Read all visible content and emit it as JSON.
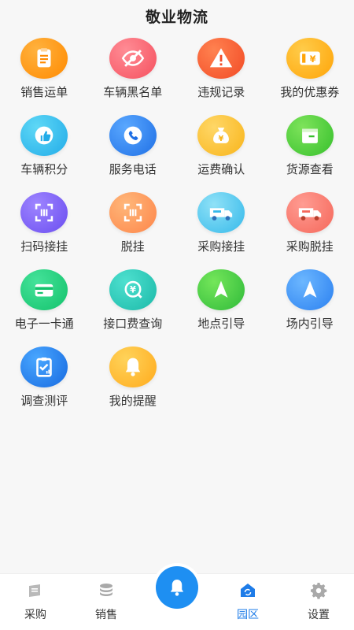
{
  "header": {
    "title": "敬业物流"
  },
  "grid": {
    "items": [
      {
        "label": "销售运单",
        "icon": "clipboard-icon"
      },
      {
        "label": "车辆黑名单",
        "icon": "eye-off-icon"
      },
      {
        "label": "违规记录",
        "icon": "warning-icon"
      },
      {
        "label": "我的优惠券",
        "icon": "coupon-icon"
      },
      {
        "label": "车辆积分",
        "icon": "thumbs-up-icon"
      },
      {
        "label": "服务电话",
        "icon": "phone-icon"
      },
      {
        "label": "运费确认",
        "icon": "money-bag-icon"
      },
      {
        "label": "货源查看",
        "icon": "box-icon"
      },
      {
        "label": "扫码接挂",
        "icon": "scan-icon"
      },
      {
        "label": "脱挂",
        "icon": "scan-icon"
      },
      {
        "label": "采购接挂",
        "icon": "truck-icon"
      },
      {
        "label": "采购脱挂",
        "icon": "truck-icon"
      },
      {
        "label": "电子一卡通",
        "icon": "card-icon"
      },
      {
        "label": "接口费查询",
        "icon": "yen-search-icon"
      },
      {
        "label": "地点引导",
        "icon": "navigation-icon"
      },
      {
        "label": "场内引导",
        "icon": "navigation-icon"
      },
      {
        "label": "调查测评",
        "icon": "survey-icon"
      },
      {
        "label": "我的提醒",
        "icon": "bell-icon"
      }
    ]
  },
  "tabbar": {
    "tabs": [
      {
        "label": "采购",
        "icon": "purchase-icon"
      },
      {
        "label": "销售",
        "icon": "database-icon"
      },
      {
        "label": "",
        "icon": "bell-icon"
      },
      {
        "label": "园区",
        "icon": "park-icon"
      },
      {
        "label": "设置",
        "icon": "gear-icon"
      }
    ],
    "active_color": "#1e7ce8"
  }
}
